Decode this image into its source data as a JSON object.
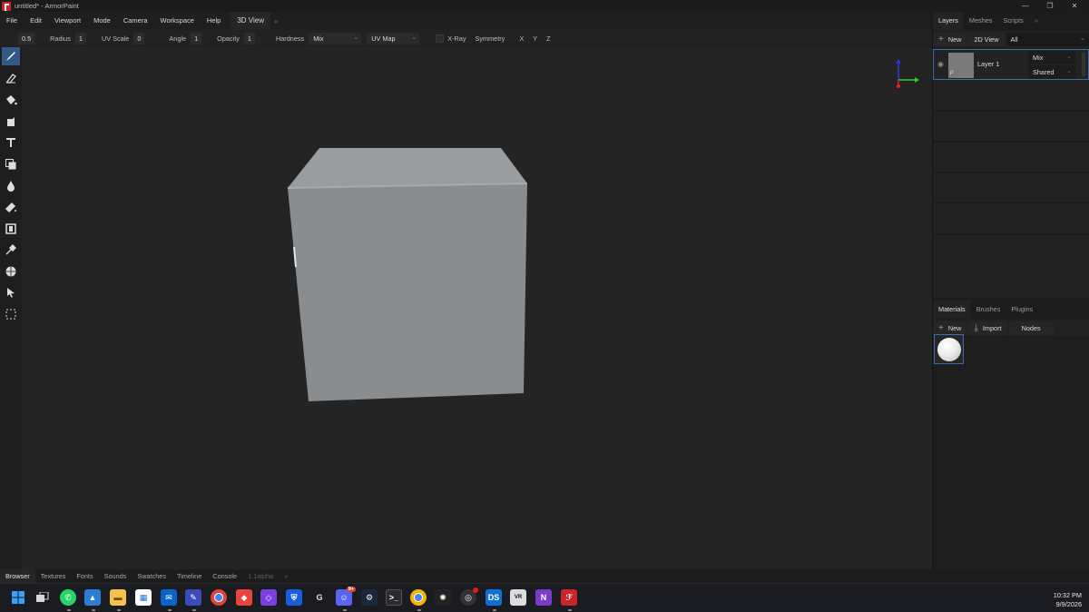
{
  "window": {
    "title": "untitled* - ArmorPaint",
    "controls": [
      "minimize-icon",
      "maximize-icon",
      "close-icon"
    ]
  },
  "menubar": {
    "items": [
      "File",
      "Edit",
      "Viewport",
      "Mode",
      "Camera",
      "Workspace",
      "Help"
    ],
    "view_tab": "3D View",
    "more": "»"
  },
  "tool_options": {
    "size_value": "0.5",
    "radius_label": "Radius",
    "radius_value": "1",
    "uvscale_label": "UV Scale",
    "uvscale_value": "0",
    "angle_label": "Angle",
    "angle_value": "1",
    "opacity_label": "Opacity",
    "opacity_value": "1",
    "hardness_label": "Hardness",
    "blend_value": "Mix",
    "uvmap_value": "UV Map",
    "xray_label": "X-Ray",
    "symmetry_label": "Symmetry",
    "x_label": "X",
    "y_label": "Y",
    "z_label": "Z"
  },
  "toolbar": {
    "tools": [
      "brush-icon",
      "eraser-icon",
      "fill-icon",
      "decal-icon",
      "text-icon",
      "clone-icon",
      "blur-icon",
      "smudge-icon",
      "particle-icon",
      "picker-icon",
      "bake-icon",
      "select-icon",
      "marquee-icon"
    ],
    "active_tool": "brush-icon"
  },
  "layers_panel": {
    "tabs": [
      "Layers",
      "Meshes",
      "Scripts"
    ],
    "more": "»",
    "new_label": "New",
    "view2d_label": "2D View",
    "filter_value": "All",
    "layer": {
      "name": "Layer 1",
      "blend": "Mix",
      "mode": "Shared",
      "thumb_glyph": "ρ"
    }
  },
  "materials_panel": {
    "tabs": [
      "Materials",
      "Brushes",
      "Plugins"
    ],
    "new_label": "New",
    "import_label": "Import",
    "nodes_label": "Nodes"
  },
  "browser": {
    "tabs": [
      "Browser",
      "Textures",
      "Fonts",
      "Sounds",
      "Swatches",
      "Timeline",
      "Console"
    ],
    "version": "1.1alpha",
    "more": "»"
  },
  "taskbar": {
    "time": "10:32 PM",
    "date": "9/9/2026",
    "discord_badge": "9+",
    "icons": [
      "windows-start-icon",
      "task-view-icon",
      "whatsapp-icon",
      "photos-icon",
      "file-explorer-icon",
      "store-icon",
      "mail-icon",
      "paint-icon",
      "chrome-icon",
      "media-icon",
      "obsidian-icon",
      "bitwarden-icon",
      "logitech-icon",
      "discord-icon",
      "steam-icon",
      "terminal-icon",
      "chrome-active-icon",
      "davinci-icon",
      "obs-icon",
      "ds-icon",
      "vr-icon",
      "visual-studio-icon",
      "armorpaint-icon"
    ]
  },
  "colors": {
    "accent": "#315a86",
    "selection": "#3a6cb5",
    "axis_x": "#e02020",
    "axis_y": "#2ad02a",
    "axis_z": "#2a3ae0"
  }
}
